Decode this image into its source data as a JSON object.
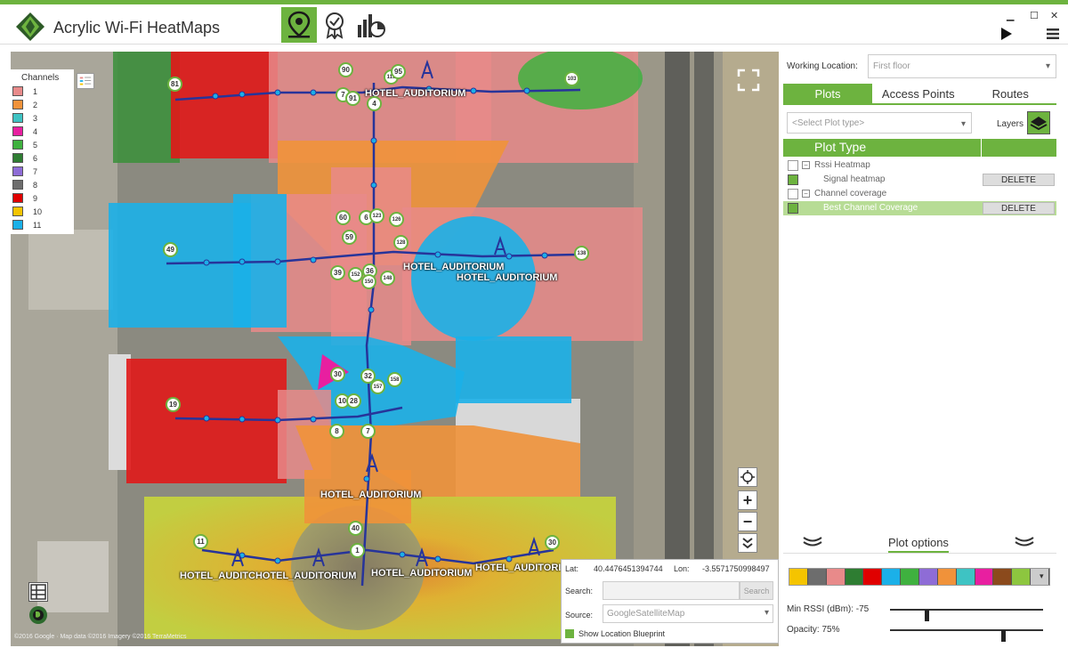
{
  "app": {
    "title": "Acrylic Wi-Fi HeatMaps"
  },
  "toolbar": {
    "buttons": [
      "map-pin-icon",
      "certificate-icon",
      "analysis-chart-icon"
    ]
  },
  "legend": {
    "title": "Channels",
    "items": [
      {
        "label": "1",
        "color": "#e88a8a"
      },
      {
        "label": "2",
        "color": "#f0923a"
      },
      {
        "label": "3",
        "color": "#3ec3c3"
      },
      {
        "label": "4",
        "color": "#e81fa0"
      },
      {
        "label": "5",
        "color": "#3fb13f"
      },
      {
        "label": "6",
        "color": "#2e7d32"
      },
      {
        "label": "7",
        "color": "#8e6cd6"
      },
      {
        "label": "8",
        "color": "#6d6d6d"
      },
      {
        "label": "9",
        "color": "#e00000"
      },
      {
        "label": "10",
        "color": "#f5c400"
      },
      {
        "label": "11",
        "color": "#1bb0e8"
      }
    ]
  },
  "map": {
    "ap_names": [
      "HOTEL_AUDITORIUM",
      "HOTEL_AUDITORIUM",
      "HOTEL_AUDITORIUM",
      "HOTEL_AUDITORIUM",
      "HOTEL_AUDITORIUM",
      "HOTEL_AUDITCHOTEL_AUDITORIUM",
      "HOTEL_AUDITORIUM",
      "HOTEL_AUDITORIUM"
    ],
    "pins": [
      "81",
      "90",
      "115",
      "95",
      "103",
      "7",
      "91",
      "4",
      "60",
      "6",
      "123",
      "126",
      "59",
      "49",
      "128",
      "138",
      "39",
      "36",
      "148",
      "152",
      "150",
      "30",
      "32",
      "157",
      "158",
      "10",
      "28",
      "19",
      "8",
      "7",
      "40",
      "1",
      "11",
      "30"
    ],
    "copyright": "©2016 Google · Map data ©2016 Imagery ©2016 TerraMetrics"
  },
  "info": {
    "lat_label": "Lat:",
    "lat_value": "40.4476451394744",
    "lon_label": "Lon:",
    "lon_value": "-3.5571750998497",
    "search_label": "Search:",
    "search_button": "Search",
    "source_label": "Source:",
    "source_value": "GoogleSatelliteMap",
    "blueprint_label": "Show Location Blueprint"
  },
  "right": {
    "working_location_label": "Working Location:",
    "working_location_value": "First floor",
    "tabs": [
      "Plots",
      "Access Points",
      "Routes"
    ],
    "plot_type_placeholder": "<Select Plot type>",
    "layers_label": "Layers",
    "table_header": "Plot Type",
    "rows": [
      {
        "label": "Rssi Heatmap",
        "group": true,
        "checked": false
      },
      {
        "label": "Signal heatmap",
        "group": false,
        "checked": true,
        "delete": "DELETE"
      },
      {
        "label": "Channel coverage",
        "group": true,
        "checked": false
      },
      {
        "label": "Best Channel Coverage",
        "group": false,
        "checked": true,
        "delete": "DELETE",
        "selected": true
      }
    ],
    "plot_options_label": "Plot options",
    "palette": [
      "#f5c400",
      "#6d6d6d",
      "#e88a8a",
      "#2e7d32",
      "#e00000",
      "#1bb0e8",
      "#3fb13f",
      "#8e6cd6",
      "#f0923a",
      "#3ec3c3",
      "#e81fa0",
      "#8b4a1c",
      "#8dc63f",
      "#cccccc"
    ],
    "min_rssi_label": "Min RSSI (dBm): -75",
    "min_rssi_value": -75,
    "opacity_label": "Opacity: 75%",
    "opacity_value": 75
  }
}
